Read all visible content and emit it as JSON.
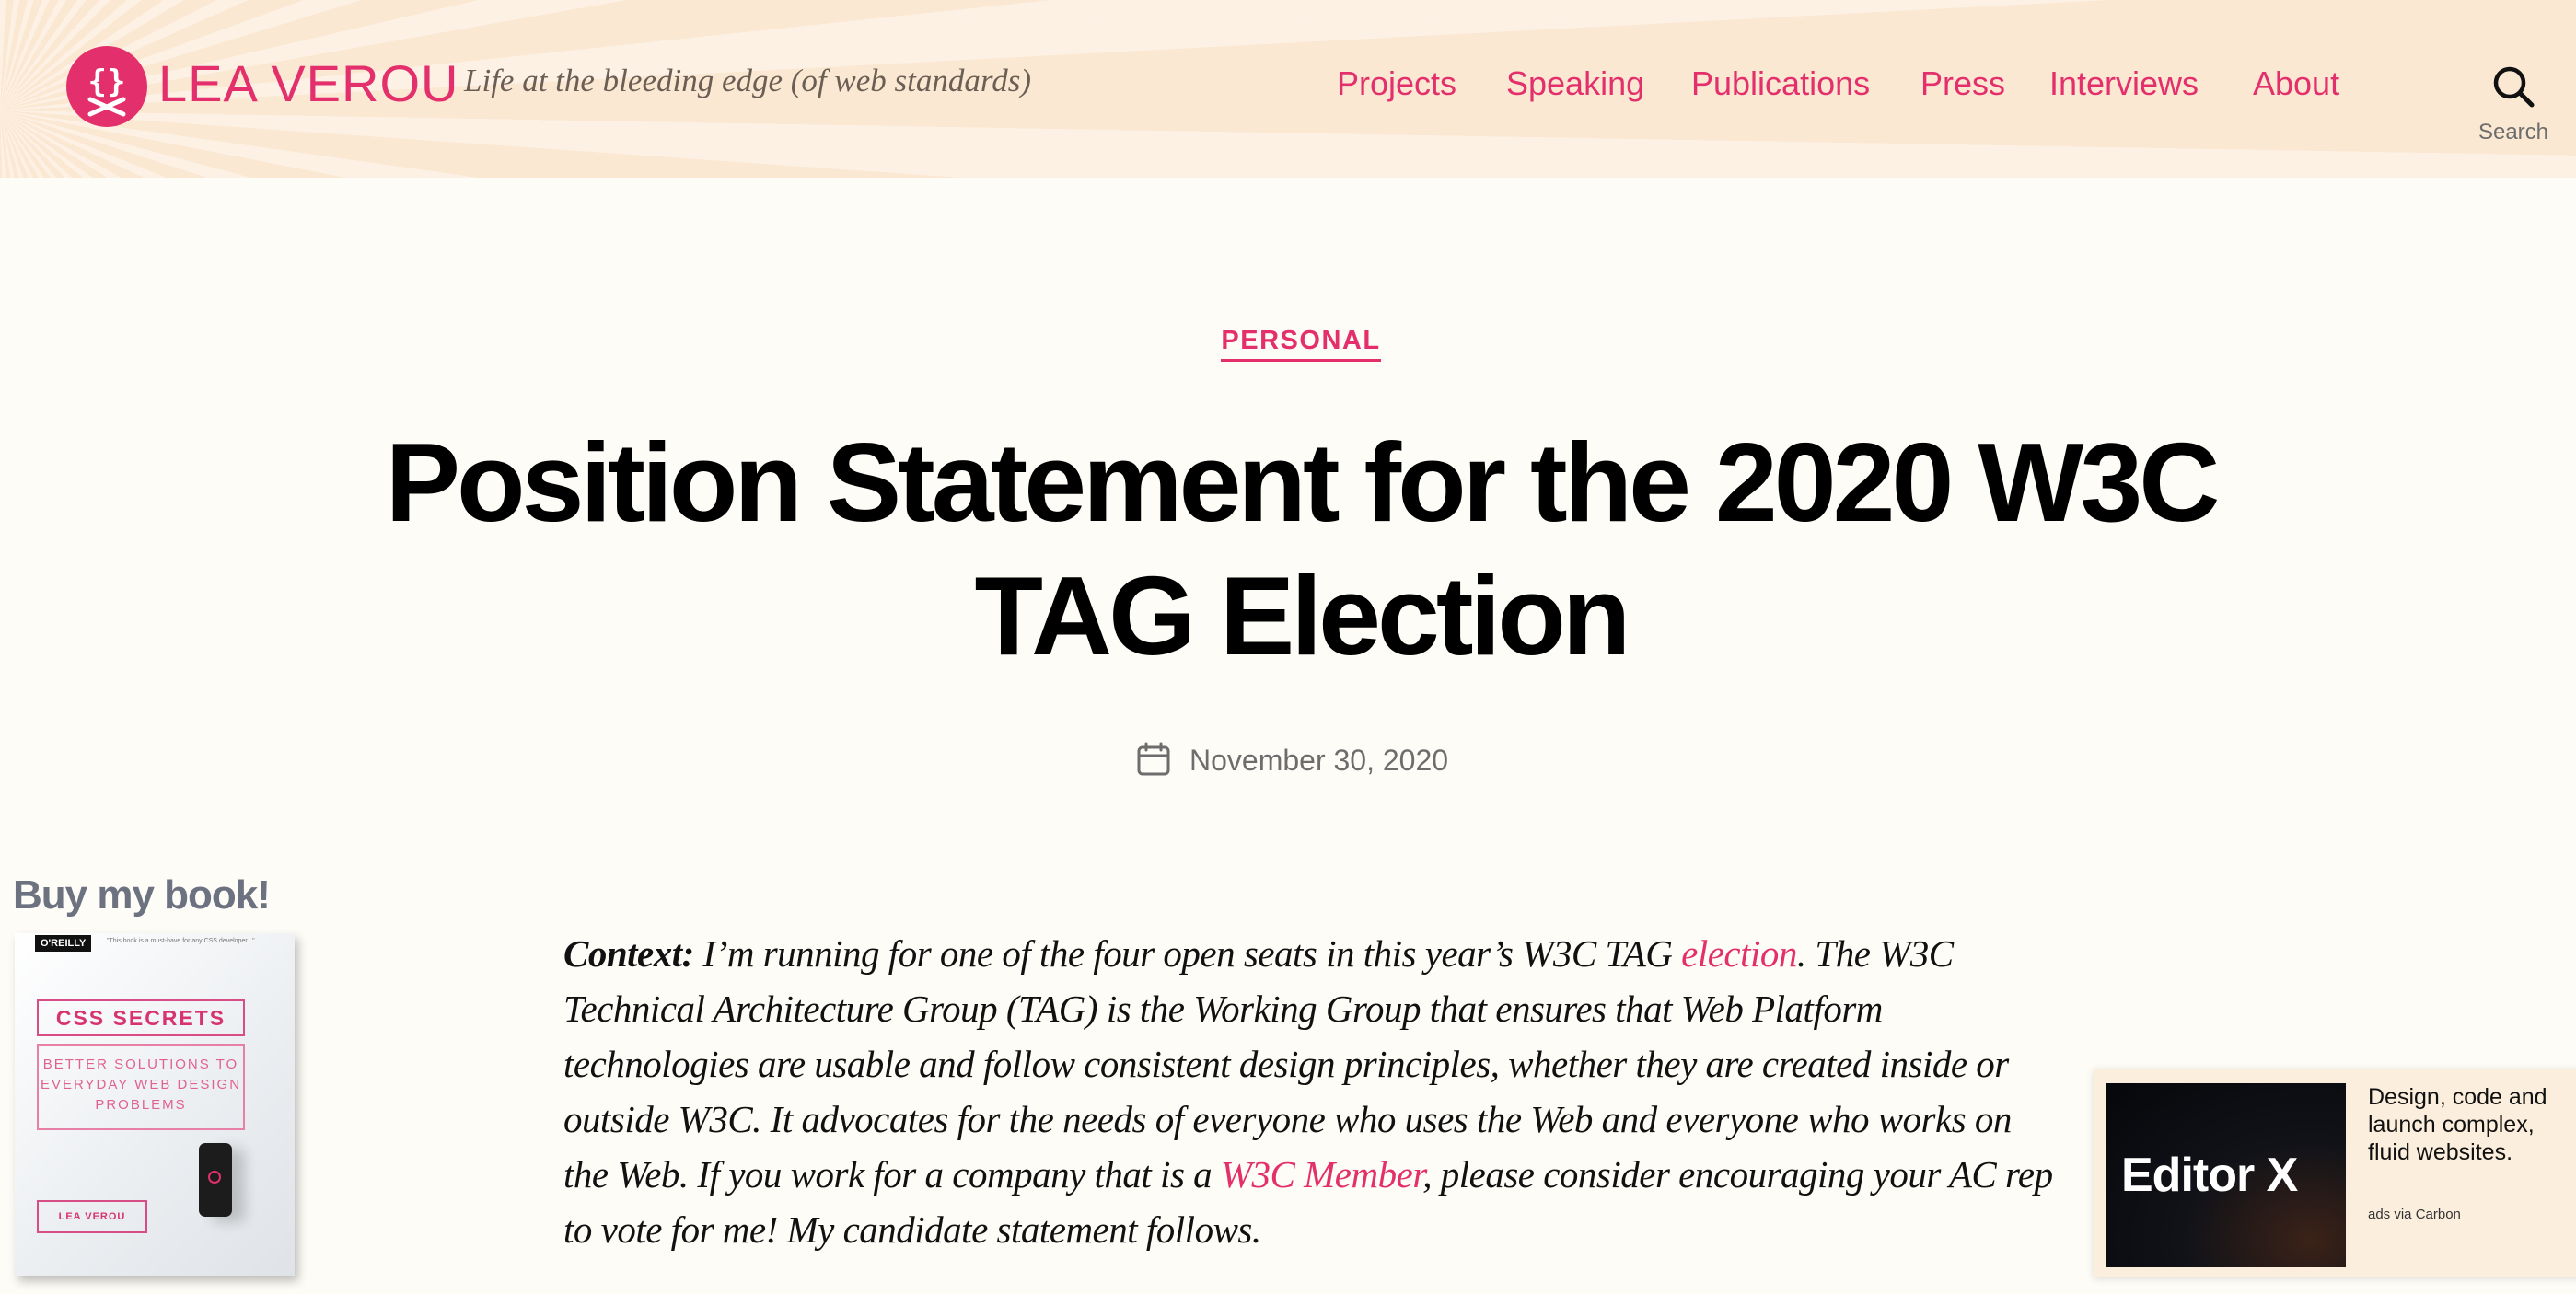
{
  "colors": {
    "accent": "#e3306c",
    "header_bg": "#fbe8d2",
    "page_bg": "#fefcf6"
  },
  "header": {
    "logo_icon": "logo-braces-crossbones-icon",
    "site_name": "LEA VEROU",
    "tagline": "Life at the bleeding edge (of web standards)",
    "nav": [
      {
        "label": "Projects"
      },
      {
        "label": "Speaking"
      },
      {
        "label": "Publications"
      },
      {
        "label": "Press"
      },
      {
        "label": "Interviews"
      },
      {
        "label": "About"
      }
    ],
    "search": {
      "icon": "search-icon",
      "label": "Search"
    }
  },
  "entry": {
    "category": "PERSONAL",
    "title": "Position Statement for the 2020 W3C TAG Election",
    "date_icon": "calendar-icon",
    "date": "November 30, 2020",
    "content": {
      "context_label": "Context:",
      "text_1": " I’m running for one of the four open seats in this year’s W3C TAG ",
      "link_election": "election",
      "text_2": ". The W3C Technical Architecture Group (TAG) is the Working Group that ensures that Web Platform technologies are usable and follow consistent design principles, whether they are created inside or outside W3C. It advocates for the needs of everyone who uses the Web and everyone who works on the Web. If you work for a company that is a ",
      "link_member": "W3C Member",
      "text_3": ", please consider encouraging your AC rep to vote for me! My candidate statement follows."
    }
  },
  "book_promo": {
    "heading": "Buy my book!",
    "cover": {
      "publisher": "O'REILLY",
      "blurb": "\"This book is a must-have for any CSS developer...\"",
      "title": "CSS SECRETS",
      "subtitle": "BETTER SOLUTIONS TO EVERYDAY WEB DESIGN PROBLEMS",
      "author": "LEA VEROU"
    }
  },
  "ad": {
    "image_text": "Editor X",
    "text": "Design, code and launch complex, fluid websites.",
    "poweredby": "ads via Carbon"
  }
}
